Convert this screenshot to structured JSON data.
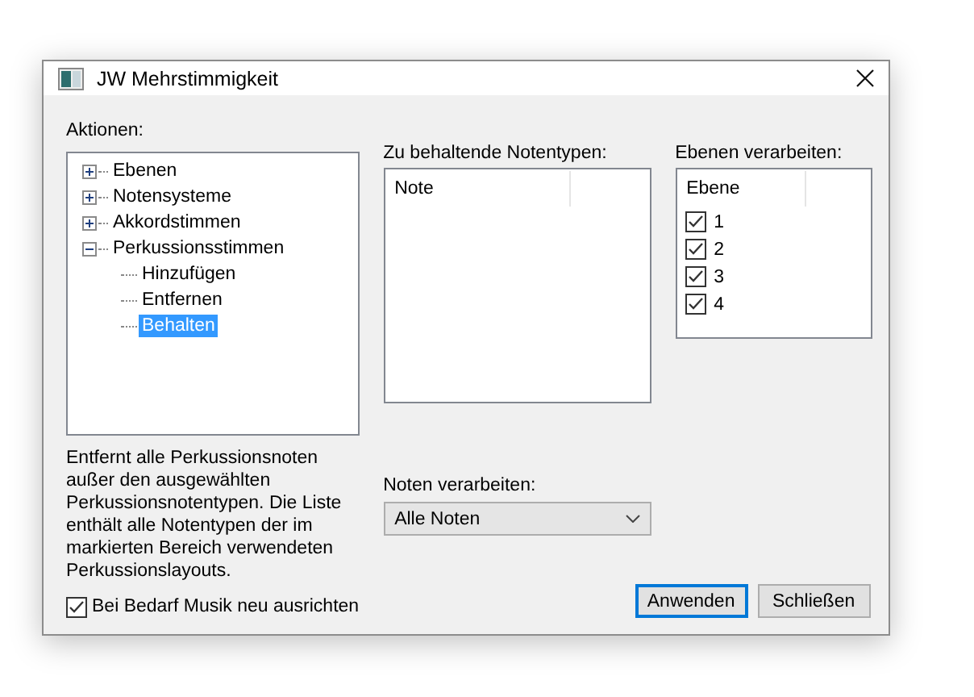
{
  "window": {
    "title": "JW Mehrstimmigkeit"
  },
  "actions": {
    "label": "Aktionen:",
    "items": [
      {
        "label": "Ebenen",
        "expanded": false,
        "selected": false
      },
      {
        "label": "Notensysteme",
        "expanded": false,
        "selected": false
      },
      {
        "label": "Akkordstimmen",
        "expanded": false,
        "selected": false
      },
      {
        "label": "Perkussionsstimmen",
        "expanded": true,
        "selected": false,
        "children": [
          {
            "label": "Hinzufügen",
            "selected": false
          },
          {
            "label": "Entfernen",
            "selected": false
          },
          {
            "label": "Behalten",
            "selected": true
          }
        ]
      }
    ]
  },
  "description": "Entfernt alle Perkussionsnoten außer den ausgewählten Perkussionsnotentypen. Die Liste enthält alle Notentypen der im markierten Bereich verwendeten Perkussionslayouts.",
  "realign": {
    "label": "Bei Bedarf Musik neu ausrichten",
    "checked": true
  },
  "note_types": {
    "label": "Zu behaltende Notentypen:",
    "columns": [
      "Note"
    ]
  },
  "process_notes": {
    "label": "Noten verarbeiten:",
    "value": "Alle Noten"
  },
  "layers": {
    "label": "Ebenen verarbeiten:",
    "columns": [
      "Ebene"
    ],
    "rows": [
      {
        "label": "1",
        "checked": true
      },
      {
        "label": "2",
        "checked": true
      },
      {
        "label": "3",
        "checked": true
      },
      {
        "label": "4",
        "checked": true
      }
    ]
  },
  "buttons": [
    {
      "label": "Anwenden",
      "default": true
    },
    {
      "label": "Schließen",
      "default": false
    }
  ]
}
